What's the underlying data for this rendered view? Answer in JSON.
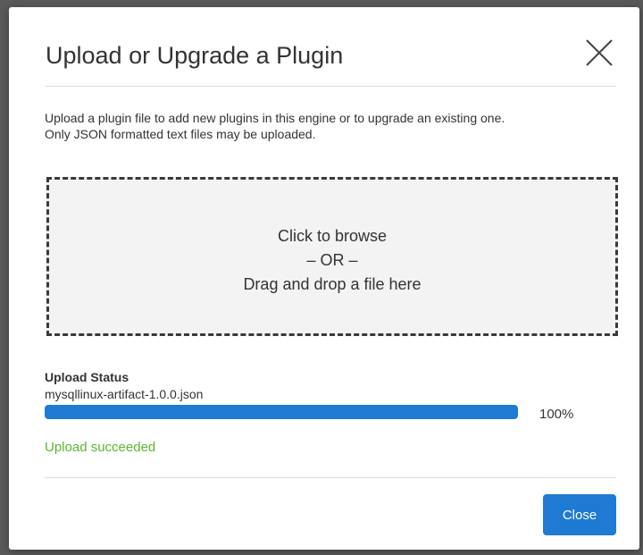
{
  "dialog": {
    "title": "Upload or Upgrade a Plugin",
    "close_icon": "close-x-icon",
    "description_line1": "Upload a plugin file to add new plugins in this engine or to upgrade an existing one.",
    "description_line2": "Only JSON formatted text files may be uploaded."
  },
  "dropzone": {
    "line1": "Click to browse",
    "line2": "– OR –",
    "line3": "Drag and drop a file here"
  },
  "upload_status": {
    "label": "Upload Status",
    "file_name": "mysqllinux-artifact-1.0.0.json",
    "progress_percent": 100,
    "progress_text": "100%",
    "result_text": "Upload succeeded"
  },
  "footer": {
    "close_label": "Close"
  },
  "colors": {
    "accent": "#1f7ad3",
    "success": "#5cb531",
    "text": "#333333"
  }
}
